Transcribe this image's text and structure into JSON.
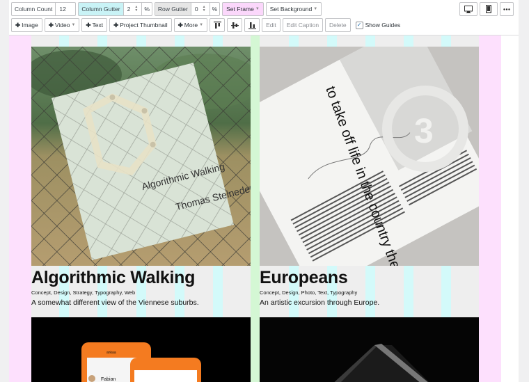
{
  "toolbar": {
    "column_count_label": "Column Count",
    "column_count_value": "12",
    "column_gutter_label": "Column Gutter",
    "column_gutter_value": "2",
    "column_gutter_unit": "%",
    "row_gutter_label": "Row Gutter",
    "row_gutter_value": "0",
    "row_gutter_unit": "%",
    "set_frame_label": "Set Frame",
    "set_background_label": "Set Background",
    "add_image_label": "Image",
    "add_video_label": "Video",
    "add_text_label": "Text",
    "add_project_thumbnail_label": "Project Thumbnail",
    "more_label": "More",
    "edit_label": "Edit",
    "edit_caption_label": "Edit Caption",
    "delete_label": "Delete",
    "show_guides_label": "Show Guides",
    "show_guides_checked": true,
    "view_icons": [
      "desktop-icon",
      "mobile-icon",
      "more-options-icon"
    ],
    "align_icons": [
      "align-top-icon",
      "align-middle-icon",
      "align-bottom-icon"
    ]
  },
  "projects": [
    {
      "title": "Algorithmic Walking",
      "tags": "Concept, Design, Strategy, Typography, Web",
      "description": "A somewhat different view of the Viennese suburbs.",
      "book_title": "Algorithmic Walking",
      "book_author": "Thomas Steineder"
    },
    {
      "title": "Europeans",
      "tags": "Concept, Design, Photo, Text, Typography",
      "description": "An artistic excursion through Europe.",
      "page_text": "to take off life in the country the dependent",
      "page_number": "3"
    },
    {
      "phone_brand": "ankaa",
      "phone_contact": "Fabian"
    },
    {}
  ],
  "colors": {
    "guide_pink": "#fde0fd",
    "guide_cyan": "#d3fafa",
    "guide_green": "#d4f7d4",
    "set_frame_bg": "#fbd7fb",
    "gutter_label_bg": "#c9f3f6"
  }
}
